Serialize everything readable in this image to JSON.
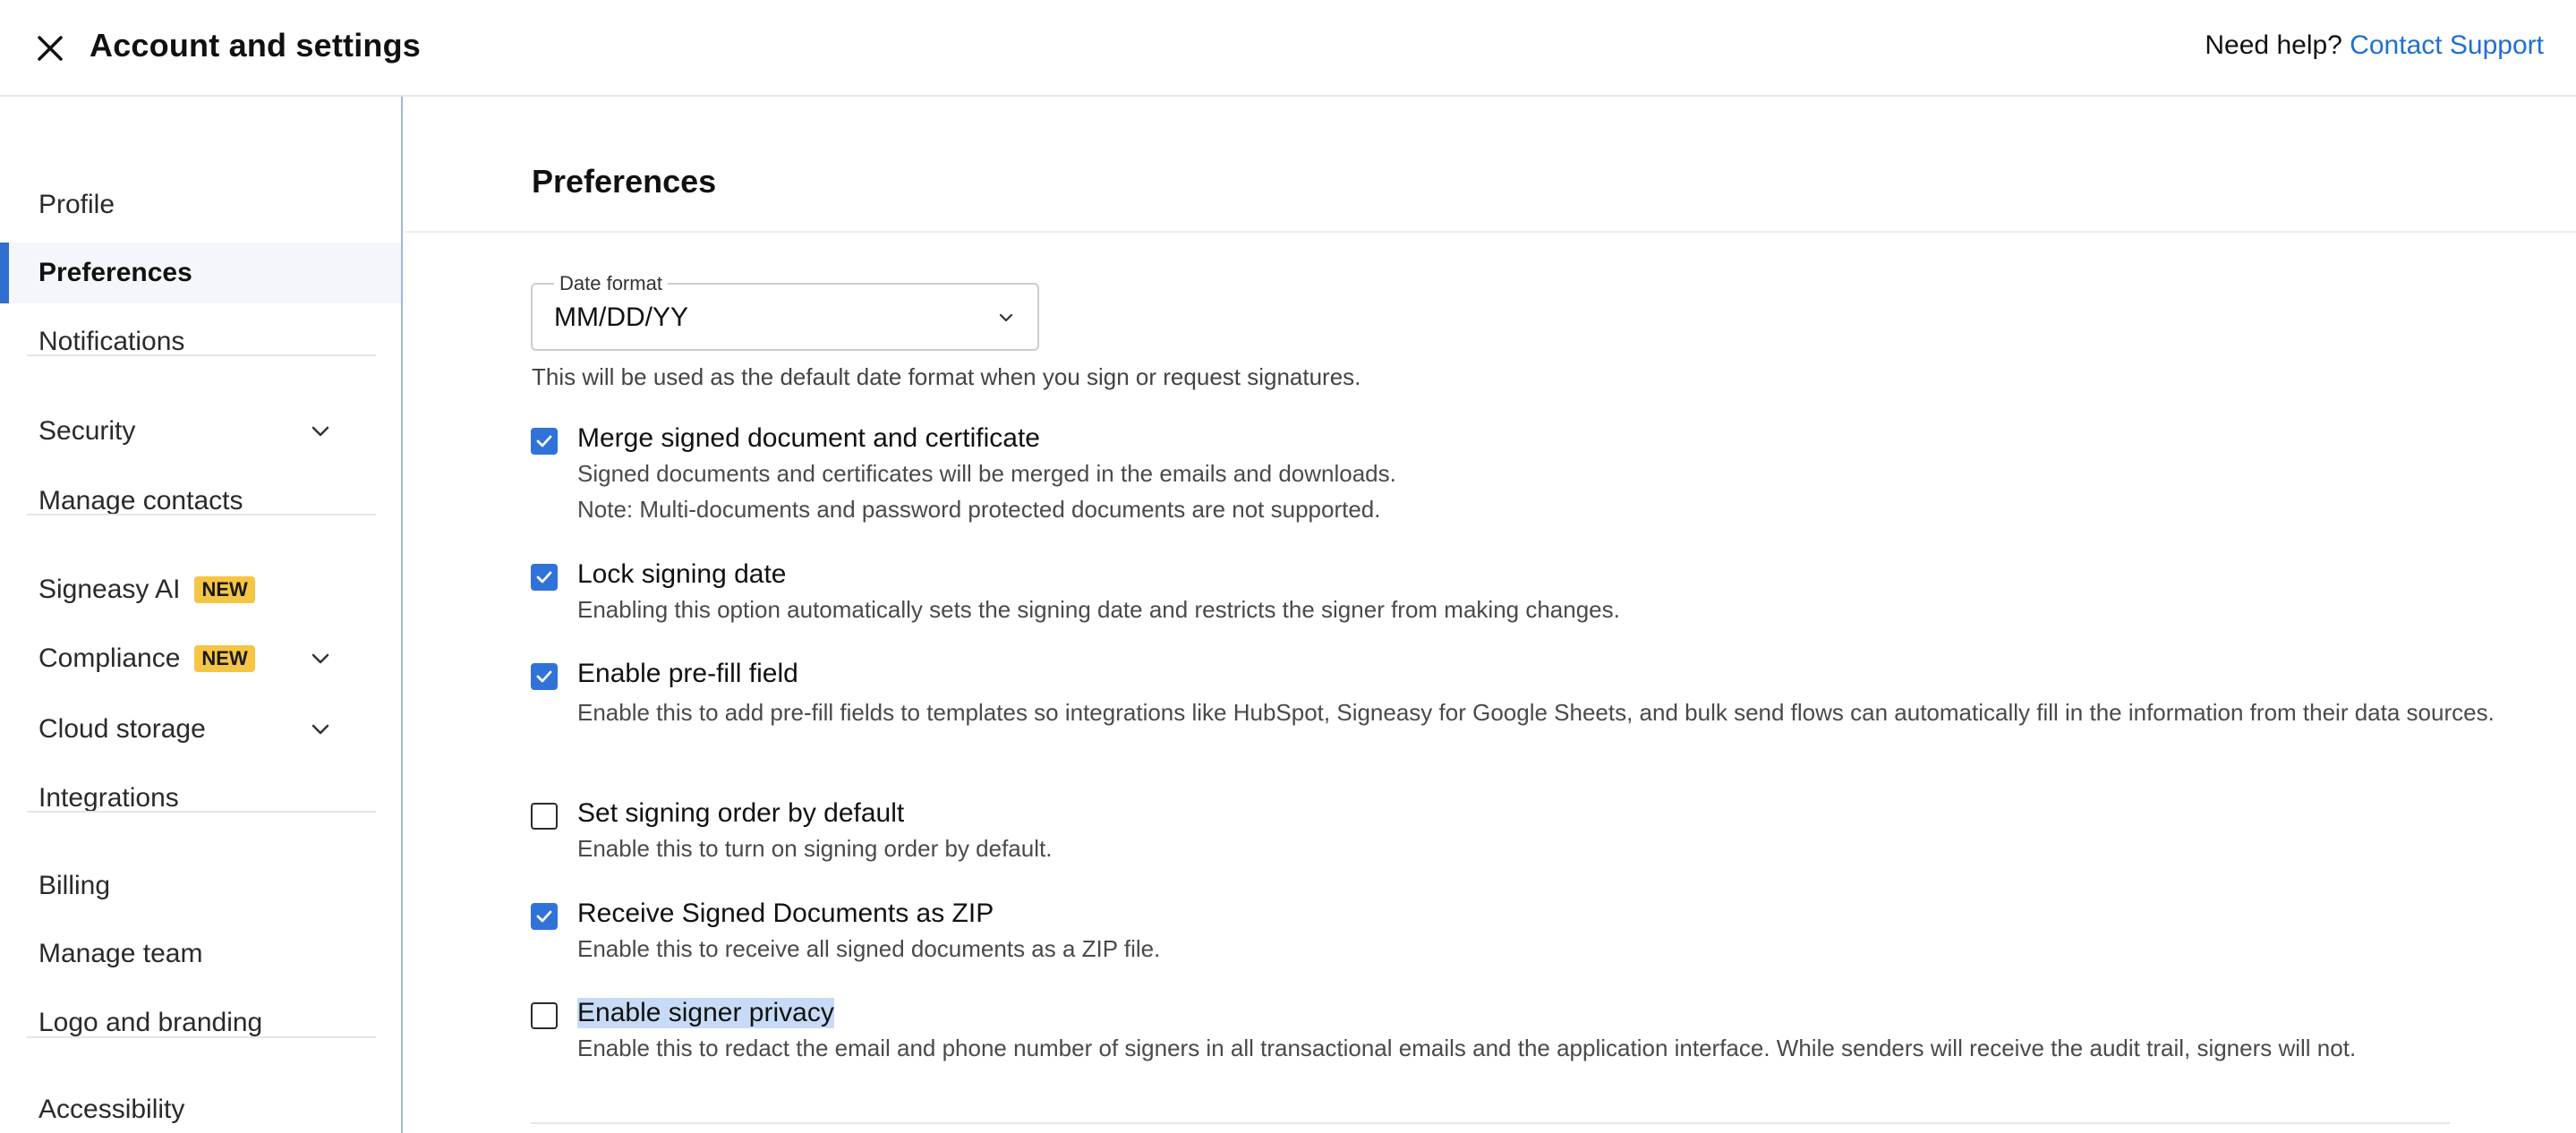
{
  "header": {
    "title": "Account and settings",
    "help_text": "Need help?",
    "support_link": "Contact Support"
  },
  "sidebar": {
    "items": [
      {
        "label": "Profile"
      },
      {
        "label": "Preferences",
        "active": true
      },
      {
        "label": "Notifications"
      },
      {
        "label": "Security",
        "expandable": true
      },
      {
        "label": "Manage contacts"
      },
      {
        "label": "Signeasy AI",
        "badge": "NEW"
      },
      {
        "label": "Compliance",
        "badge": "NEW",
        "expandable": true
      },
      {
        "label": "Cloud storage",
        "expandable": true
      },
      {
        "label": "Integrations"
      },
      {
        "label": "Billing"
      },
      {
        "label": "Manage team"
      },
      {
        "label": "Logo and branding"
      },
      {
        "label": "Accessibility"
      }
    ]
  },
  "main": {
    "title": "Preferences",
    "date_format": {
      "legend": "Date format",
      "value": "MM/DD/YY",
      "help": "This will be used as the default date format when you sign or request signatures."
    },
    "options": [
      {
        "label": "Merge signed document and certificate",
        "checked": true,
        "desc": [
          "Signed documents and certificates will be merged in the emails and downloads.",
          "Note: Multi-documents and password protected documents are not supported."
        ]
      },
      {
        "label": "Lock signing date",
        "checked": true,
        "desc": [
          "Enabling this option automatically sets the signing date and restricts the signer from making changes."
        ]
      },
      {
        "label": "Enable pre-fill field",
        "checked": true,
        "desc": [
          "Enable this to add pre-fill fields to templates so integrations like HubSpot, Signeasy for Google Sheets, and bulk send flows can automatically fill in the information from their data sources."
        ]
      },
      {
        "label": "Set signing order by default",
        "checked": false,
        "desc": [
          "Enable this to turn on signing order by default."
        ]
      },
      {
        "label": "Receive Signed Documents as ZIP",
        "checked": true,
        "desc": [
          "Enable this to receive all signed documents as a ZIP file."
        ]
      },
      {
        "label": "Enable signer privacy",
        "checked": false,
        "selected_text": true,
        "desc": [
          "Enable this to redact the email and phone number of signers in all transactional emails and the application interface. While senders will receive the audit trail, signers will not."
        ]
      }
    ]
  },
  "colors": {
    "accent": "#2f73d8",
    "link": "#1f6fd1",
    "badge": "#f7c544"
  }
}
